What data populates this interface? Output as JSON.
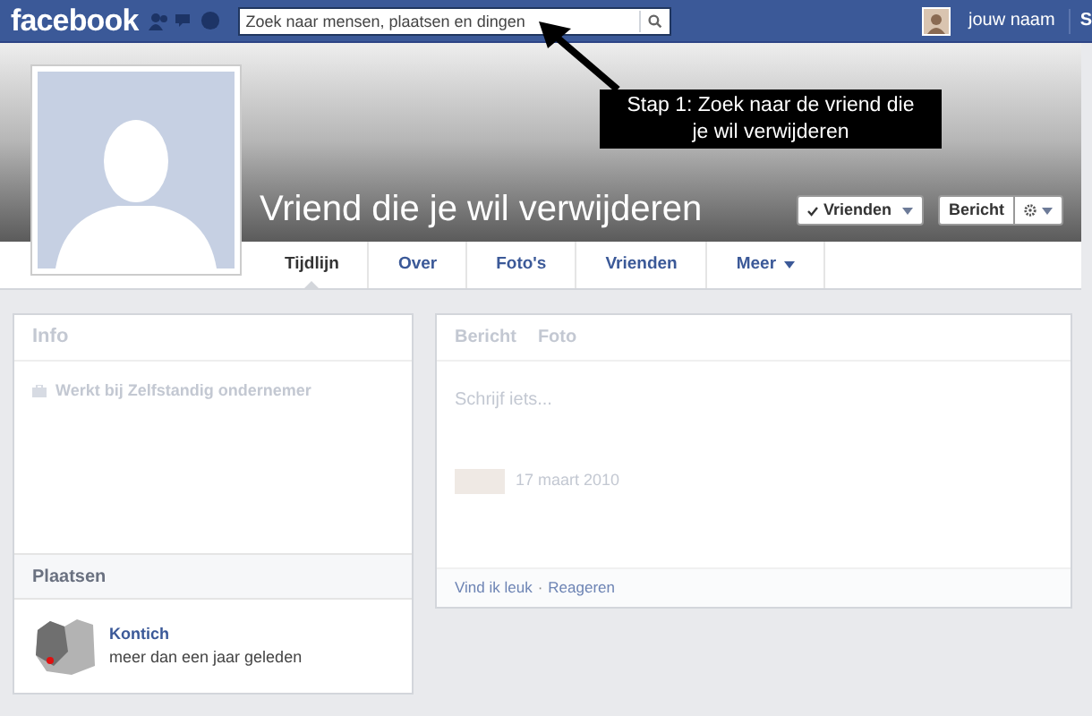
{
  "header": {
    "logo": "facebook",
    "search": {
      "placeholder": "Zoek naar mensen, plaatsen en dingen"
    },
    "user_name": "jouw naam",
    "cut_text": "S"
  },
  "annotation": {
    "text": "Stap 1: Zoek naar de vriend die je wil verwijderen"
  },
  "profile": {
    "name": "Vriend die je wil verwijderen",
    "buttons": [
      {
        "label": "Vrienden",
        "kind": "friends"
      },
      {
        "label": "Bericht",
        "kind": "message"
      }
    ]
  },
  "tabs": [
    {
      "label": "Tijdlijn",
      "selected": true
    },
    {
      "label": "Over",
      "selected": false
    },
    {
      "label": "Foto's",
      "selected": false
    },
    {
      "label": "Vrienden",
      "selected": false
    },
    {
      "label": "Meer",
      "selected": false,
      "dropdown": true
    }
  ],
  "info_card": {
    "title": "Info",
    "items": [
      "Werkt bij Zelfstandig ondernemer"
    ]
  },
  "places": {
    "title": "Plaatsen",
    "items": [
      {
        "name": "Kontich",
        "time": "meer dan een jaar geleden"
      }
    ]
  },
  "composer": {
    "actions": [
      "Bericht",
      "Foto"
    ],
    "placeholder": "Schrijf iets..."
  },
  "post": {
    "date": "17 maart 2010",
    "actions": [
      "Vind ik leuk",
      "Reageren"
    ],
    "separator": "·"
  }
}
